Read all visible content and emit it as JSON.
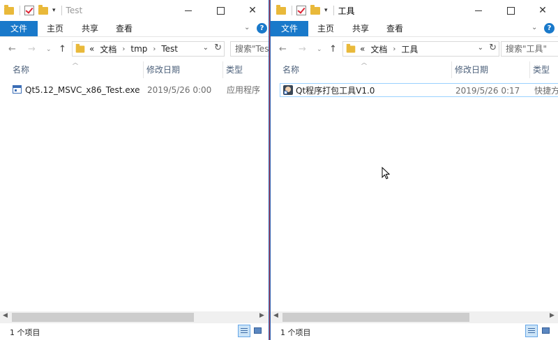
{
  "left": {
    "title": "Test",
    "tabs": {
      "file": "文件",
      "home": "主页",
      "share": "共享",
      "view": "查看"
    },
    "address": {
      "prefix": "«",
      "crumbs": [
        "文档",
        "tmp",
        "Test"
      ]
    },
    "search_placeholder": "搜索\"Test\"",
    "columns": {
      "name": "名称",
      "date": "修改日期",
      "type": "类型"
    },
    "rows": [
      {
        "name": "Qt5.12_MSVC_x86_Test.exe",
        "date": "2019/5/26 0:00",
        "type": "应用程序",
        "icon": "exe-icon"
      }
    ],
    "status": "1 个项目"
  },
  "right": {
    "title": "工具",
    "tabs": {
      "file": "文件",
      "home": "主页",
      "share": "共享",
      "view": "查看"
    },
    "address": {
      "prefix": "«",
      "crumbs": [
        "文档",
        "工具"
      ]
    },
    "search_placeholder": "搜索\"工具\"",
    "columns": {
      "name": "名称",
      "date": "修改日期",
      "type": "类型"
    },
    "rows": [
      {
        "name": "Qt程序打包工具V1.0",
        "date": "2019/5/26 0:17",
        "type": "快捷方式",
        "icon": "shortcut-icon"
      }
    ],
    "status": "1 个项目"
  },
  "colors": {
    "accent": "#1979ca",
    "window_border": "#2a63b8",
    "desktop": "#c0393f"
  }
}
